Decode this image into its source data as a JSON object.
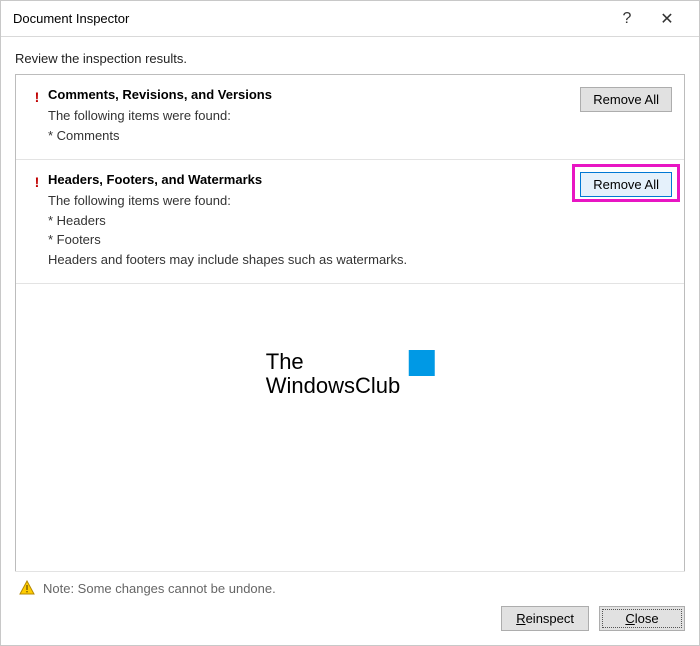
{
  "titlebar": {
    "title": "Document Inspector",
    "help": "?",
    "close": "✕"
  },
  "subtitle": "Review the inspection results.",
  "sections": [
    {
      "title": "Comments, Revisions, and Versions",
      "intro": "The following items were found:",
      "items": [
        "* Comments"
      ],
      "note": "",
      "remove_label": "Remove All"
    },
    {
      "title": "Headers, Footers, and Watermarks",
      "intro": "The following items were found:",
      "items": [
        "* Headers",
        "* Footers"
      ],
      "note": "Headers and footers may include shapes such as watermarks.",
      "remove_label": "Remove All"
    }
  ],
  "watermark": {
    "line1": "The",
    "line2": "WindowsClub"
  },
  "footer": {
    "note": "Note: Some changes cannot be undone.",
    "reinspect": "Reinspect",
    "close": "Close"
  }
}
